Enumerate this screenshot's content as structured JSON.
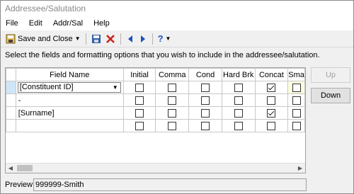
{
  "window": {
    "title": "Addressee/Salutation"
  },
  "menu": [
    "File",
    "Edit",
    "Addr/Sal",
    "Help"
  ],
  "toolbar": {
    "save_close_label": "Save and Close"
  },
  "instructions": "Select the fields and formatting options that you wish to include in the addressee/salutation.",
  "grid": {
    "columns": [
      "Field Name",
      "Initial",
      "Comma",
      "Cond",
      "Hard Brk",
      "Concat",
      "Sma"
    ],
    "rows": [
      {
        "field": "[Constituent ID]",
        "checks": [
          false,
          false,
          false,
          false,
          true,
          false
        ],
        "dropdown": true
      },
      {
        "field": "-",
        "checks": [
          false,
          false,
          false,
          false,
          false,
          false
        ],
        "dropdown": false
      },
      {
        "field": "[Surname]",
        "checks": [
          false,
          false,
          false,
          false,
          true,
          false
        ],
        "dropdown": false
      },
      {
        "field": "",
        "checks": [
          false,
          false,
          false,
          false,
          false,
          false
        ],
        "dropdown": false
      }
    ]
  },
  "buttons": {
    "up": "Up",
    "down": "Down"
  },
  "preview": {
    "label": "Preview:",
    "value": "999999-Smith"
  }
}
